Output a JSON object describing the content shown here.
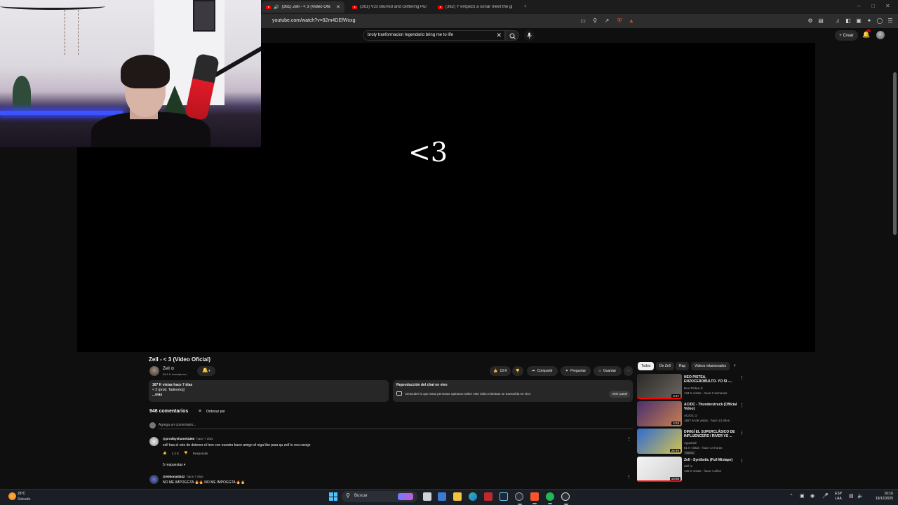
{
  "browser": {
    "tabs": [
      {
        "label": "(361) Zell - < 3 (Video Oficial",
        "active": true
      },
      {
        "label": "(361) V2x Blurred and Glittering Purp",
        "active": false
      },
      {
        "label": "(362) Y empezó a sonar meet the gra",
        "active": false
      }
    ],
    "new_tab_glyph": "+",
    "url": "youtube.com/watch?v=92m4DEfWxxg"
  },
  "youtube": {
    "search_query": "broly tranformacion legendario bring me to life",
    "create_label": "Crear",
    "player_text": "<3"
  },
  "video": {
    "title": "Zell - < 3 (Video Oficial)",
    "channel": "Zell ⊙",
    "subscribers": "98.6 K suscriptores",
    "actions": {
      "likes": "13 K",
      "share": "Compartir",
      "ask": "Preguntar",
      "save": "Guardar",
      "more": "⋯"
    },
    "description": {
      "stats": "167 K vistas  hace 7 días",
      "line1": "< 3 (prod. Tadeoexq)",
      "more": "...más"
    },
    "live_chat": {
      "title": "Reproducción del chat en vivo",
      "desc": "Descubre lo que otras personas opinaron sobre este video mientras se transmitía en vivo.",
      "open": "Abrir panel"
    }
  },
  "comments": {
    "count": "946 comentarios",
    "sort_label": "Ordenar por",
    "add_placeholder": "Agrega un comentario...",
    "items": [
      {
        "author": "@prodbyshamel4365",
        "time": "hace 7 días",
        "text": "zell has el reto de detener el tren con nuestro buen amigo el niga like para qu zell lo vea csesjo",
        "likes": "1.2 K",
        "reply": "Responder"
      },
      {
        "author": "@ebkonal4042",
        "time": "hace 7 días",
        "text": "NO ME IMPOGGTA 🔥🔥 NO ME IMPOGGTA 🔥🔥",
        "likes": "",
        "reply": ""
      }
    ],
    "replies_label": "5 respuestas"
  },
  "related": {
    "chips": [
      "Todos",
      "De Zell",
      "Rap",
      "Videos relacionados"
    ],
    "items": [
      {
        "title": "NEO PISTEA, ENZOCEROBULTO- YO SI -...",
        "channel": "Neo Pistea ⊙",
        "meta": "134 K vistas · hace 2 semanas",
        "duration": "3:17",
        "badge": "",
        "colors": [
          "#2b2a27",
          "#6b6660"
        ]
      },
      {
        "title": "AC/DC - Thunderstruck (Official Video)",
        "channel": "AC/DC ⊙",
        "meta": "1657 M de vistas · hace 13 años",
        "duration": "4:53",
        "badge": "",
        "colors": [
          "#4a2f6e",
          "#c88050"
        ]
      },
      {
        "title": "DIRIGÍ EL SUPERCLÁSICO DE INFLUENCERS / RIVER VS ...",
        "channel": "Agustoid",
        "meta": "81 K vistas · hace 14 horas",
        "duration": "26:49",
        "badge": "Nuevo",
        "colors": [
          "#2e6bd6",
          "#d6c24a"
        ]
      },
      {
        "title": "Zell - Synthetic (Full Mixtape)",
        "channel": "Zell ⊙",
        "meta": "136 K vistas · hace 4 años",
        "duration": "10:58",
        "badge": "",
        "colors": [
          "#f4f4f4",
          "#cfcfcf"
        ]
      }
    ]
  },
  "taskbar": {
    "weather_temp": "26°C",
    "weather_desc": "Soleado",
    "search_label": "Buscar",
    "lang_line1": "ESP",
    "lang_line2": "LAA",
    "time": "10:16",
    "date": "18/12/2025"
  }
}
